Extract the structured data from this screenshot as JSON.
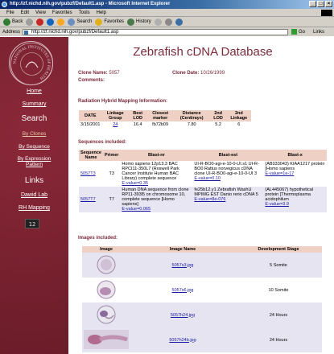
{
  "window": {
    "title": "http://zf.nichd.nih.gov/pubzf/Default1.asp - Microsoft Internet Explorer",
    "buttons": [
      "_",
      "□",
      "×"
    ]
  },
  "menu": [
    "File",
    "Edit",
    "View",
    "Favorites",
    "Tools",
    "Help"
  ],
  "toolbar": {
    "back": "Back",
    "search": "Search",
    "favorites": "Favorites",
    "history": "History"
  },
  "address": {
    "label": "Address",
    "url": "http://zf.nichd.nih.gov/pubzf/Default1.asp",
    "go": "Go",
    "links": "Links"
  },
  "sidebar": {
    "seal_text": "NATIONAL INSTITUTES OF HEALTH",
    "home": "Home",
    "summary": "Summary",
    "search": "Search",
    "by_clones": "By Clones",
    "by_sequence": "By Sequence",
    "by_expression": "By Expression Pattern",
    "links": "Links",
    "dawid_lab": "Dawid Lab",
    "rh_mapping": "RH Mapping",
    "counter": "12"
  },
  "page": {
    "title": "Zebrafish cDNA Database",
    "clone_name_label": "Clone Name:",
    "clone_name": "5057",
    "clone_date_label": "Clone Date:",
    "clone_date": "10/26/1999",
    "comments_label": "Comments:"
  },
  "rh": {
    "heading": "Radiation Hybrid Mapping Information:",
    "headers": [
      "DATE",
      "Linkage Group",
      "Best LOD",
      "Closest marker",
      "Distance (Centirays)",
      "2nd LOD",
      "2nd Linkage"
    ],
    "row": [
      "3/15/2001",
      "24",
      "16.4",
      "fb72b09",
      "7.80",
      "5.2",
      "6"
    ]
  },
  "sequences": {
    "heading": "Sequences included:",
    "headers": [
      "Sequence Name",
      "Primer",
      "Blast-nr",
      "Blast-est",
      "Blast-x"
    ],
    "rows": [
      {
        "name": "5057T3",
        "primer": "T3",
        "nr": "Homo sapiens 12p13.3 BAC RPCI11-350L7 (Roswell Park Cancer Institute Human BAC Library) complete sequence",
        "nr_e": "E-value=0.35",
        "est": "UI-R-BO0-agi-e-10-0-UI.s1 UI-R-BO0 Rattus norvegicus cDNA clone UI-R-BO0-agi-e-10-0-UI 3",
        "est_e": "E-value=0.10",
        "x": "(AB033043) KIAA1217 protein [Homo sapiens",
        "x_e": "E-value=1e-17"
      },
      {
        "name": "5057T7",
        "primer": "T7",
        "nr": "Human DNA sequence from clone RP11-393l5 on chromosome 10, complete sequence [Homo sapiens]",
        "nr_e": "E-value=0.065",
        "est": "fe25b12.y1 Zebrafish WashU MPIMG EST Danio rerio cDNA 5",
        "est_e": "E-value=8e-076",
        "x": "(AL445067) hypothetical protein [Thermoplasma acidophilum",
        "x_e": "E-value=3.9"
      }
    ]
  },
  "images": {
    "heading": "Images included:",
    "headers": [
      "Image",
      "Image Name",
      "Development Stage"
    ],
    "rows": [
      {
        "name": "5057s3.jpg",
        "stage": "5 Somite"
      },
      {
        "name": "5057s6.jpg",
        "stage": "10 Somite"
      },
      {
        "name": "5057h24.jpg",
        "stage": "24 Hours"
      },
      {
        "name": "5057h24b.jpg",
        "stage": "24 Hours"
      }
    ]
  },
  "colors": {
    "sidebar": "#7a2230",
    "accent": "#7b2a3a",
    "header_bg": "#efd0c4",
    "link": "#1a1aa0"
  }
}
